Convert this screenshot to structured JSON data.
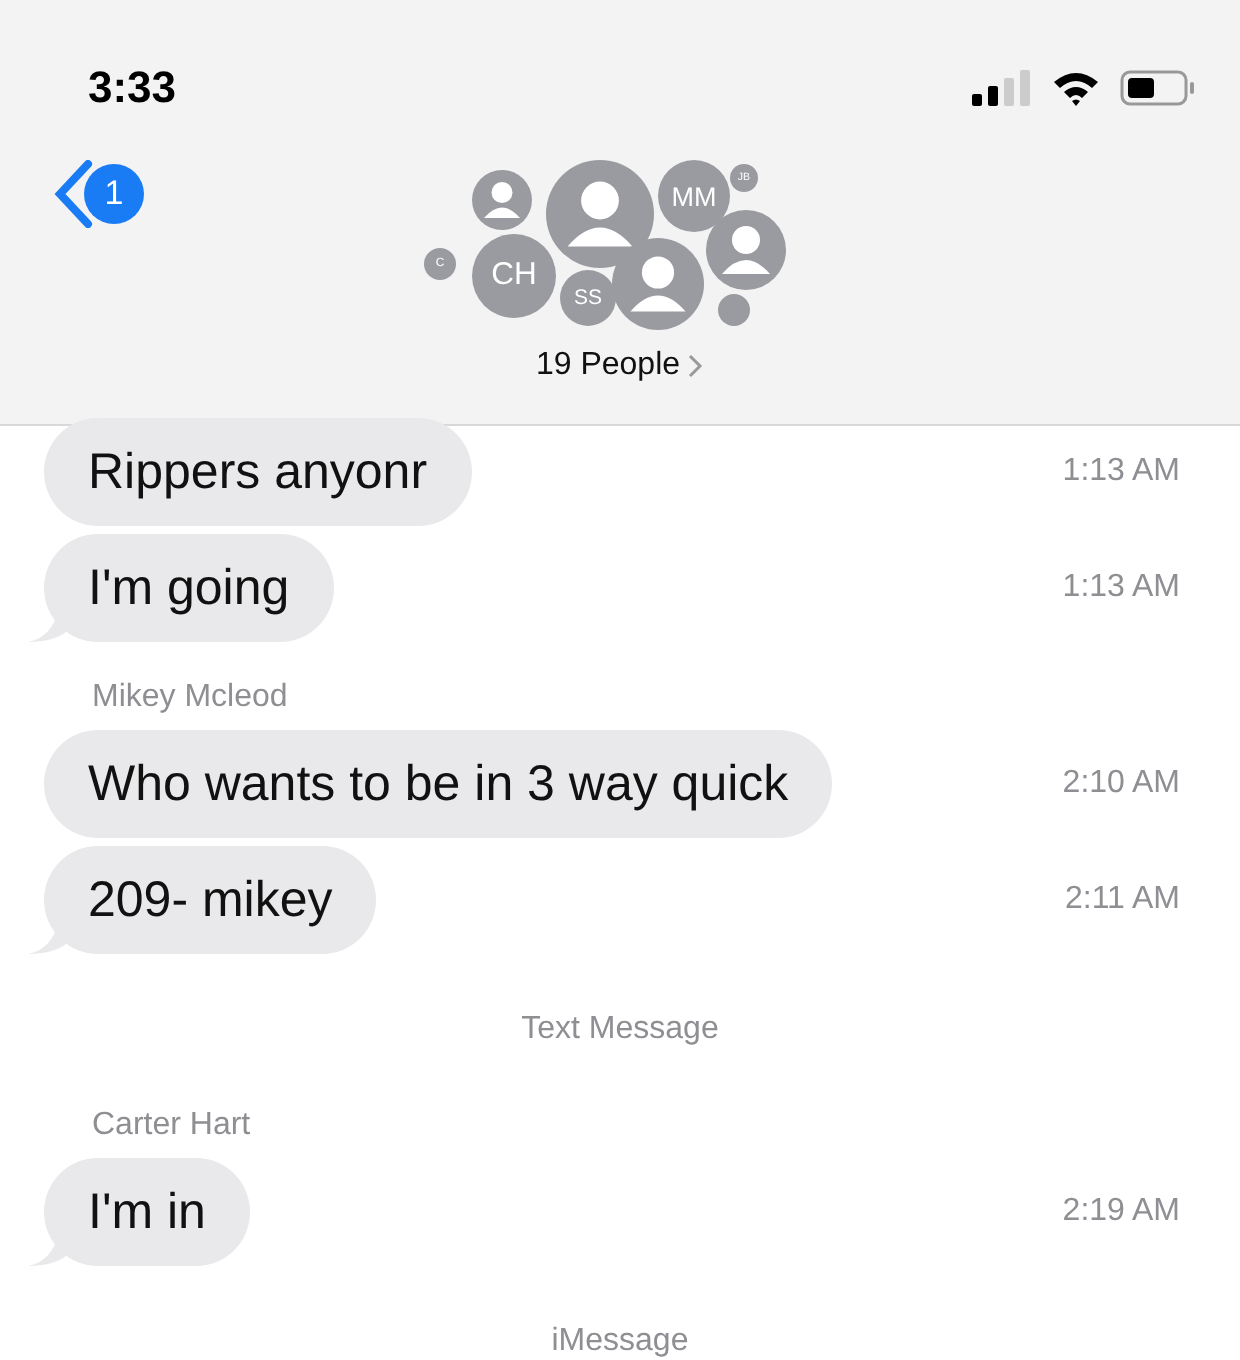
{
  "status_bar": {
    "time": "3:33"
  },
  "header": {
    "back_badge": "1",
    "title": "19 People",
    "avatars": [
      {
        "kind": "silhouette"
      },
      {
        "kind": "silhouette"
      },
      {
        "kind": "initials",
        "initials": "MM"
      },
      {
        "kind": "initials",
        "initials": "JB"
      },
      {
        "kind": "initials",
        "initials": "C"
      },
      {
        "kind": "initials",
        "initials": "CH"
      },
      {
        "kind": "initials",
        "initials": "SS"
      },
      {
        "kind": "silhouette"
      },
      {
        "kind": "silhouette"
      },
      {
        "kind": "blank"
      }
    ]
  },
  "messages": [
    {
      "kind": "bubble",
      "text": "Rippers anyonr",
      "time": "1:13 AM",
      "tail": false
    },
    {
      "kind": "bubble",
      "text": "I'm going",
      "time": "1:13 AM",
      "tail": true
    },
    {
      "kind": "sender",
      "text": "Mikey  Mcleod"
    },
    {
      "kind": "bubble",
      "text": "Who wants to be in 3 way quick",
      "time": "2:10 AM",
      "tail": false
    },
    {
      "kind": "bubble",
      "text": "209- mikey",
      "time": "2:11 AM",
      "tail": true
    },
    {
      "kind": "service",
      "text": "Text Message"
    },
    {
      "kind": "sender",
      "text": "Carter Hart"
    },
    {
      "kind": "bubble",
      "text": "I'm in",
      "time": "2:19 AM",
      "tail": true
    },
    {
      "kind": "service",
      "text": "iMessage"
    }
  ]
}
